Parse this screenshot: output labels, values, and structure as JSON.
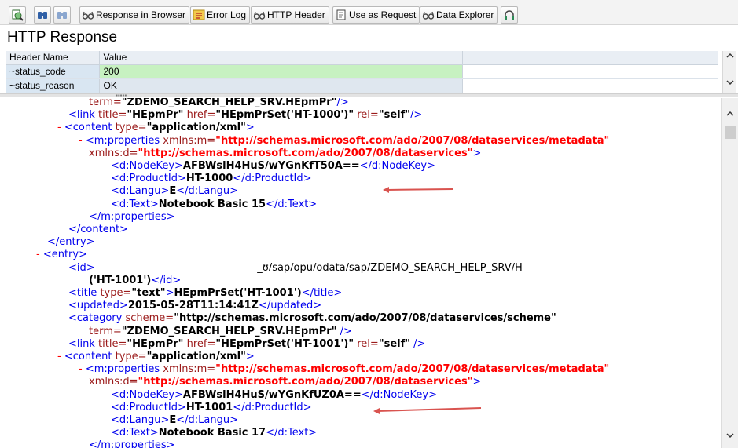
{
  "toolbar": {
    "buttons": [
      {
        "label": "",
        "icon": "refresh-icon"
      },
      {
        "label": "",
        "icon": "find-icon"
      },
      {
        "label": "",
        "icon": "find-next-icon"
      },
      {
        "label": "Response in Browser",
        "icon": "glasses-icon"
      },
      {
        "label": "Error Log",
        "icon": "error-log-icon"
      },
      {
        "label": "HTTP Header",
        "icon": "glasses-icon"
      },
      {
        "label": "Use as Request",
        "icon": "document-icon"
      },
      {
        "label": "Data Explorer",
        "icon": "glasses-icon"
      },
      {
        "label": "",
        "icon": "headset-icon"
      }
    ]
  },
  "page": {
    "title": "HTTP Response"
  },
  "header_table": {
    "columns": [
      "Header Name",
      "Value"
    ],
    "rows": [
      {
        "name": "~status_code",
        "value": "200"
      },
      {
        "name": "~status_reason",
        "value": "OK"
      }
    ]
  },
  "xml": {
    "lines": [
      [
        [
          "i",
          "term="
        ],
        [
          "v",
          "\"ZDEMO_SEARCH_HELP_SRV.HEpmPr\""
        ],
        [
          "t",
          "/>"
        ]
      ],
      [
        [
          "t",
          "<link "
        ],
        [
          "i",
          "title="
        ],
        [
          "v",
          "\"HEpmPr\""
        ],
        [
          "i",
          " href="
        ],
        [
          "v",
          "\"HEpmPrSet('HT-1000')\""
        ],
        [
          "i",
          " rel="
        ],
        [
          "v",
          "\"self\""
        ],
        [
          "t",
          "/>"
        ]
      ],
      [
        [
          "s",
          "- "
        ],
        [
          "t",
          "<content "
        ],
        [
          "i",
          "type="
        ],
        [
          "v",
          "\"application/xml\""
        ],
        [
          "t",
          ">"
        ]
      ],
      [
        [
          "s",
          "- "
        ],
        [
          "t",
          "<m:properties "
        ],
        [
          "i",
          "xmlns:m="
        ],
        [
          "u",
          "\"http://schemas.microsoft.com/ado/2007/08/dataservices/metadata\""
        ]
      ],
      [
        [
          "i",
          "xmlns:d="
        ],
        [
          "u",
          "\"http://schemas.microsoft.com/ado/2007/08/dataservices\""
        ],
        [
          "t",
          ">"
        ]
      ],
      [
        [
          "t",
          "<d:NodeKey>"
        ],
        [
          "v",
          "AFBWslH4HuS/wYGnKfT50A=="
        ],
        [
          "t",
          "</d:NodeKey>"
        ]
      ],
      [
        [
          "t",
          "<d:ProductId>"
        ],
        [
          "v",
          "HT-1000"
        ],
        [
          "t",
          "</d:ProductId>"
        ]
      ],
      [
        [
          "t",
          "<d:Langu>"
        ],
        [
          "v",
          "E"
        ],
        [
          "t",
          "</d:Langu>"
        ]
      ],
      [
        [
          "t",
          "<d:Text>"
        ],
        [
          "v",
          "Notebook Basic 15"
        ],
        [
          "t",
          "</d:Text>"
        ]
      ],
      [
        [
          "t",
          "</m:properties>"
        ]
      ],
      [
        [
          "t",
          "</content>"
        ]
      ],
      [
        [
          "t",
          "</entry>"
        ]
      ],
      [
        [
          "s",
          "- "
        ],
        [
          "t",
          "<entry>"
        ]
      ],
      [
        [
          "t",
          "<id>"
        ],
        [
          "x",
          "                                                  "
        ],
        [
          "x",
          "_ʊ/sap/opu/odata/sap/ZDEMO_SEARCH_HELP_SRV/H"
        ]
      ],
      [
        [
          "v",
          "('HT-1001')"
        ],
        [
          "t",
          "</id>"
        ]
      ],
      [
        [
          "t",
          "<title "
        ],
        [
          "i",
          "type="
        ],
        [
          "v",
          "\"text\""
        ],
        [
          "t",
          ">"
        ],
        [
          "v",
          "HEpmPrSet('HT-1001')"
        ],
        [
          "t",
          "</title>"
        ]
      ],
      [
        [
          "t",
          "<updated>"
        ],
        [
          "v",
          "2015-05-28T11:14:41Z"
        ],
        [
          "t",
          "</updated>"
        ]
      ],
      [
        [
          "t",
          "<category "
        ],
        [
          "i",
          "scheme="
        ],
        [
          "v",
          "\"http://schemas.microsoft.com/ado/2007/08/dataservices/scheme\""
        ]
      ],
      [
        [
          "i",
          "term="
        ],
        [
          "v",
          "\"ZDEMO_SEARCH_HELP_SRV.HEpmPr\""
        ],
        [
          "t",
          " />"
        ]
      ],
      [
        [
          "t",
          "<link "
        ],
        [
          "i",
          "title="
        ],
        [
          "v",
          "\"HEpmPr\""
        ],
        [
          "i",
          " href="
        ],
        [
          "v",
          "\"HEpmPrSet('HT-1001')\""
        ],
        [
          "i",
          " rel="
        ],
        [
          "v",
          "\"self\""
        ],
        [
          "t",
          " />"
        ]
      ],
      [
        [
          "s",
          "- "
        ],
        [
          "t",
          "<content "
        ],
        [
          "i",
          "type="
        ],
        [
          "v",
          "\"application/xml\""
        ],
        [
          "t",
          ">"
        ]
      ],
      [
        [
          "s",
          "- "
        ],
        [
          "t",
          "<m:properties "
        ],
        [
          "i",
          "xmlns:m="
        ],
        [
          "u",
          "\"http://schemas.microsoft.com/ado/2007/08/dataservices/metadata\""
        ]
      ],
      [
        [
          "i",
          "xmlns:d="
        ],
        [
          "u",
          "\"http://schemas.microsoft.com/ado/2007/08/dataservices\""
        ],
        [
          "t",
          ">"
        ]
      ],
      [
        [
          "t",
          "<d:NodeKey>"
        ],
        [
          "v",
          "AFBWslH4HuS/wYGnKfUZ0A=="
        ],
        [
          "t",
          "</d:NodeKey>"
        ]
      ],
      [
        [
          "t",
          "<d:ProductId>"
        ],
        [
          "v",
          "HT-1001"
        ],
        [
          "t",
          "</d:ProductId>"
        ]
      ],
      [
        [
          "t",
          "<d:Langu>"
        ],
        [
          "v",
          "E"
        ],
        [
          "t",
          "</d:Langu>"
        ]
      ],
      [
        [
          "t",
          "<d:Text>"
        ],
        [
          "v",
          "Notebook Basic 17"
        ],
        [
          "t",
          "</d:Text>"
        ]
      ],
      [
        [
          "t",
          "</m:properties>"
        ]
      ]
    ]
  },
  "colors": {
    "tag": "#0000ee",
    "attr": "#9b1a1a",
    "url": "#ff0000",
    "status_ok_bg": "#c7f1c1",
    "annotation_arrow": "#d9534f"
  }
}
